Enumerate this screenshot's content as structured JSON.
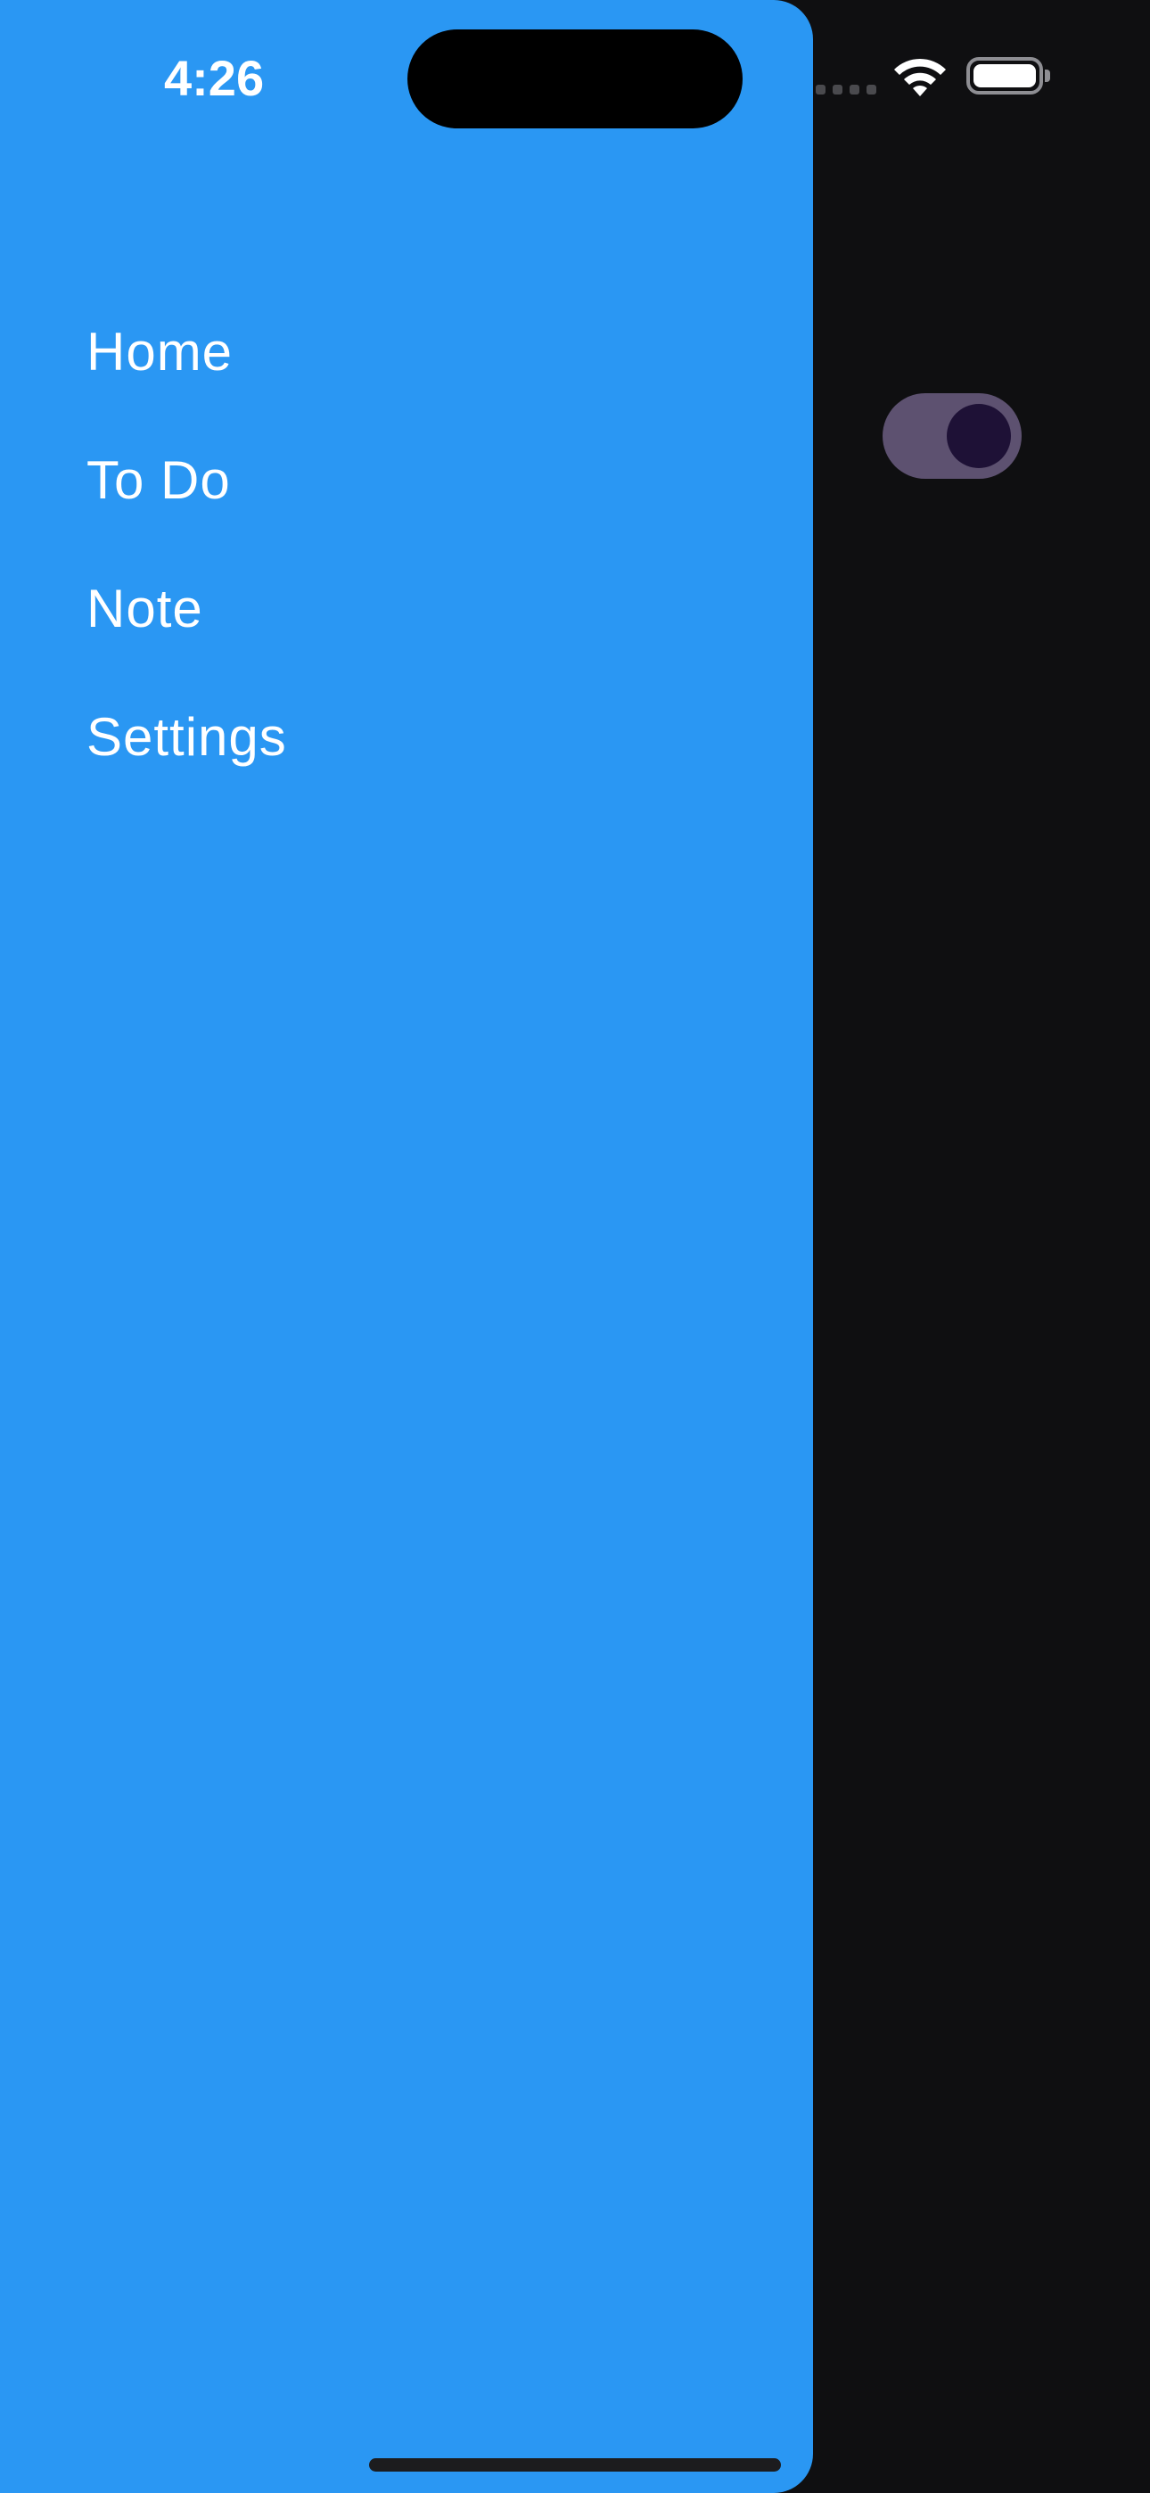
{
  "status_bar": {
    "time": "4:26",
    "wifi_icon": "wifi-icon",
    "battery_icon": "battery-icon",
    "signal_icon": "cellular-signal-icon"
  },
  "drawer": {
    "background_color": "#2a97f3",
    "items": [
      {
        "label": "Home"
      },
      {
        "label": "To Do"
      },
      {
        "label": "Note"
      },
      {
        "label": "Settings"
      }
    ]
  },
  "background": {
    "color": "#0f0f11",
    "toggle": {
      "state": "on",
      "track_color": "#5d5170",
      "knob_color": "#1e1136"
    }
  }
}
